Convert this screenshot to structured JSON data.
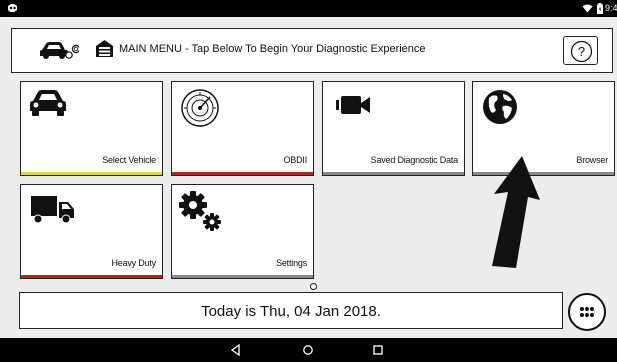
{
  "status_bar": {
    "time": "9:40"
  },
  "header": {
    "title": "MAIN MENU - Tap Below To Begin Your Diagnostic Experience"
  },
  "tiles": [
    {
      "label": "Select Vehicle",
      "icon": "car-icon",
      "accent": "#e3d84a"
    },
    {
      "label": "OBDII",
      "icon": "gauge-icon",
      "accent": "#b12a22"
    },
    {
      "label": "Saved Diagnostic Data",
      "icon": "video-camera-icon",
      "accent": "#8a8a8a"
    },
    {
      "label": "Browser",
      "icon": "globe-icon",
      "accent": "#8a8a8a"
    },
    {
      "label": "Heavy Duty",
      "icon": "truck-icon",
      "accent": "#b12a22"
    },
    {
      "label": "Settings",
      "icon": "gears-icon",
      "accent": "#8a8a8a"
    }
  ],
  "date_panel": {
    "text": "Today is Thu, 04 Jan 2018."
  },
  "nav_bar": {
    "buttons": [
      "back-icon",
      "home-icon",
      "recents-icon"
    ]
  }
}
